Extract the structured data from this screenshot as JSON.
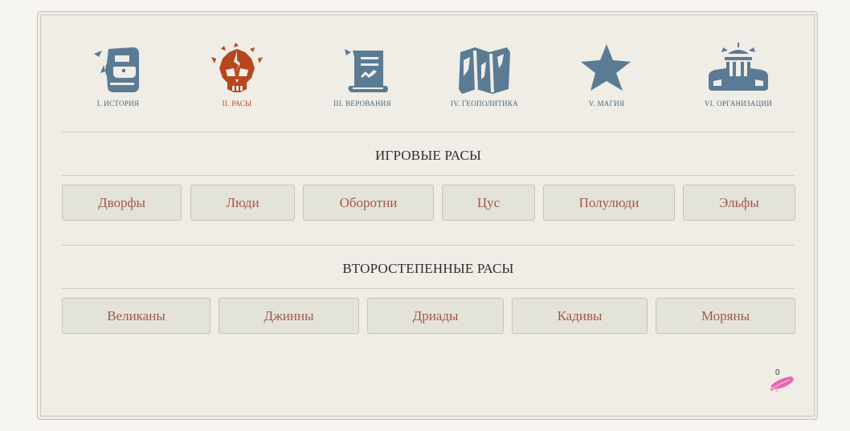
{
  "nav": {
    "items": [
      {
        "label": "I. ИСТОРИЯ",
        "icon": "book-bag-icon",
        "active": false
      },
      {
        "label": "II. РАСЫ",
        "icon": "skull-mask-icon",
        "active": true
      },
      {
        "label": "III. ВЕРОВАНИЯ",
        "icon": "scroll-icon",
        "active": false
      },
      {
        "label": "IV. ГЕОПОЛИТИКА",
        "icon": "map-icon",
        "active": false
      },
      {
        "label": "V. МАГИЯ",
        "icon": "star-icon",
        "active": false
      },
      {
        "label": "VI. ОРГАНИЗАЦИИ",
        "icon": "temple-icon",
        "active": false
      }
    ]
  },
  "playable": {
    "title": "ИГРОВЫЕ РАСЫ",
    "buttons": [
      "Дворфы",
      "Люди",
      "Оборотни",
      "Цус",
      "Полулюди",
      "Эльфы"
    ]
  },
  "secondary": {
    "title": "ВТОРОСТЕПЕННЫЕ РАСЫ",
    "buttons": [
      "Великаны",
      "Джинны",
      "Дриады",
      "Кадивы",
      "Моряны"
    ]
  },
  "counter": {
    "value": "0",
    "icon": "pink-feather-icon"
  },
  "colors": {
    "icon_default": "#5b7a94",
    "icon_active": "#b8461d",
    "button_text": "#a2574b",
    "button_bg": "#e4e3da",
    "panel_bg": "#efede6"
  }
}
